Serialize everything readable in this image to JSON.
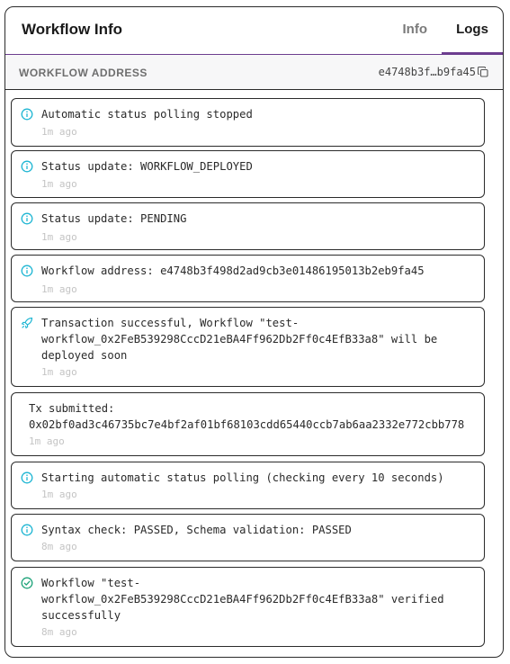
{
  "header": {
    "title": "Workflow Info",
    "tabs": [
      {
        "label": "Info",
        "active": false
      },
      {
        "label": "Logs",
        "active": true
      }
    ]
  },
  "address_row": {
    "label": "WORKFLOW ADDRESS",
    "value": "e4748b3f…b9fa45",
    "copy_icon": "copy-icon"
  },
  "colors": {
    "accent": "#6c3d8f",
    "info": "#1fb6d3",
    "success": "#1fa37a"
  },
  "logs": [
    {
      "icon": "info-icon",
      "message": "Automatic status polling stopped",
      "time": "1m ago"
    },
    {
      "icon": "info-icon",
      "message": "Status update: WORKFLOW_DEPLOYED",
      "time": "1m ago"
    },
    {
      "icon": "info-icon",
      "message": "Status update: PENDING",
      "time": "1m ago"
    },
    {
      "icon": "info-icon",
      "message": "Workflow address: e4748b3f498d2ad9cb3e01486195013b2eb9fa45",
      "time": "1m ago"
    },
    {
      "icon": "rocket-icon",
      "message": "Transaction successful, Workflow \"test-\nworkflow_0x2FeB539298CccD21eBA4Ff962Db2Ff0c4EfB33a8\" will be\ndeployed soon",
      "time": "1m ago"
    },
    {
      "icon": "",
      "message": "Tx submitted:\n0x02bf0ad3c46735bc7e4bf2af01bf68103cdd65440ccb7ab6aa2332e772cbb778",
      "time": "1m ago"
    },
    {
      "icon": "info-icon",
      "message": "Starting automatic status polling (checking every 10 seconds)",
      "time": "1m ago"
    },
    {
      "icon": "info-icon",
      "message": "Syntax check: PASSED, Schema validation: PASSED",
      "time": "8m ago"
    },
    {
      "icon": "check-circle-icon",
      "message": "Workflow \"test-\nworkflow_0x2FeB539298CccD21eBA4Ff962Db2Ff0c4EfB33a8\" verified\nsuccessfully",
      "time": "8m ago"
    }
  ]
}
